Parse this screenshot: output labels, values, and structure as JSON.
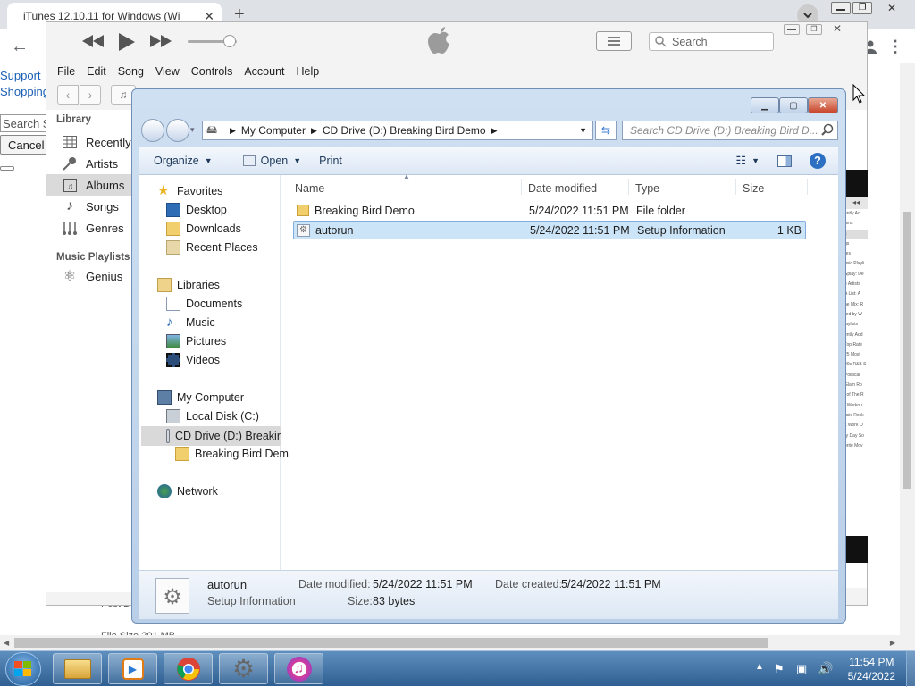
{
  "browser": {
    "tab_title": "iTunes 12.10.11 for Windows (Wi",
    "new_tab": "+",
    "links": [
      "Support",
      "Shopping"
    ],
    "search_field": "Search S",
    "cancel_button": "Cancel",
    "bottom_texts": [
      "Post D",
      "File Size 201 MB"
    ]
  },
  "itunes": {
    "search_placeholder": "Search",
    "menu": [
      "File",
      "Edit",
      "Song",
      "View",
      "Controls",
      "Account",
      "Help"
    ],
    "sidebar": {
      "library_header": "Library",
      "library_items": [
        {
          "label": "Recently",
          "icon": "grid-icon"
        },
        {
          "label": "Artists",
          "icon": "microphone-icon"
        },
        {
          "label": "Albums",
          "icon": "album-icon"
        },
        {
          "label": "Songs",
          "icon": "note-icon"
        },
        {
          "label": "Genres",
          "icon": "genres-icon"
        }
      ],
      "playlists_header": "Music Playlists",
      "playlist_items": [
        {
          "label": "Genius",
          "icon": "atom-icon"
        }
      ]
    },
    "right_snippets": [
      "ently Ad",
      "ums",
      "s",
      "gs",
      "res",
      "usic Playli",
      "Splay: De",
      "e Artists",
      "A List: A",
      "he Mix: R",
      "red by W",
      "laylists",
      "ently Add",
      "Top Rate",
      "25 Most",
      "90s R&B S",
      "Political",
      "Glam Ro",
      "l of The R",
      "t Workou",
      "usic Rock",
      "k Work O",
      "ry Day So",
      "orite Mov"
    ]
  },
  "explorer": {
    "address": {
      "segments": [
        "My Computer",
        "CD Drive (D:) Breaking Bird Demo"
      ],
      "search_placeholder": "Search CD Drive (D:) Breaking Bird D..."
    },
    "toolbar": {
      "organize": "Organize",
      "open": "Open",
      "print": "Print"
    },
    "nav": {
      "favorites": "Favorites",
      "desktop": "Desktop",
      "downloads": "Downloads",
      "recent_places": "Recent Places",
      "libraries": "Libraries",
      "documents": "Documents",
      "music": "Music",
      "pictures": "Pictures",
      "videos": "Videos",
      "my_computer": "My Computer",
      "local_disk": "Local Disk (C:)",
      "cd_drive": "CD Drive (D:) Breakir",
      "breaking_bird": "Breaking Bird Dem",
      "network": "Network"
    },
    "columns": {
      "name": "Name",
      "date_modified": "Date modified",
      "type": "Type",
      "size": "Size"
    },
    "files": [
      {
        "name": "Breaking Bird Demo",
        "date": "5/24/2022 11:51 PM",
        "type": "File folder",
        "size": ""
      },
      {
        "name": "autorun",
        "date": "5/24/2022 11:51 PM",
        "type": "Setup Information",
        "size": "1 KB"
      }
    ],
    "details": {
      "name": "autorun",
      "type": "Setup Information",
      "date_modified_label": "Date modified:",
      "date_modified": "5/24/2022 11:51 PM",
      "date_created_label": "Date created:",
      "date_created": "5/24/2022 11:51 PM",
      "size_label": "Size:",
      "size": "83 bytes"
    }
  },
  "taskbar": {
    "time": "11:54 PM",
    "date": "5/24/2022"
  },
  "colors": {
    "selection": "#cce4f7",
    "taskbar": "#3f6ea1",
    "link": "#1a5fb4"
  }
}
